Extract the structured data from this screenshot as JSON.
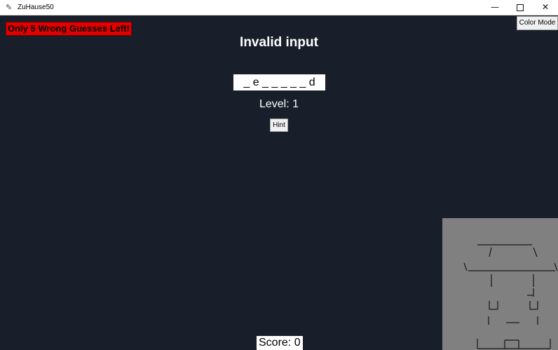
{
  "window": {
    "title": "ZuHause50",
    "icon": "feather-icon",
    "controls": {
      "minimize": "—",
      "close": "✕"
    }
  },
  "game": {
    "warning": "Only 5 Wrong Guesses Left!",
    "color_mode_label": "Color Mode",
    "message": "Invalid input",
    "word_display": "_ e _ _ _ _ _ d",
    "level_text": "Level: 1",
    "hint_label": "Hint",
    "score_text": "Score: 0"
  },
  "colors": {
    "background": "#181f2b",
    "warning_bg": "#e00000",
    "hangman_panel": "#808080"
  }
}
